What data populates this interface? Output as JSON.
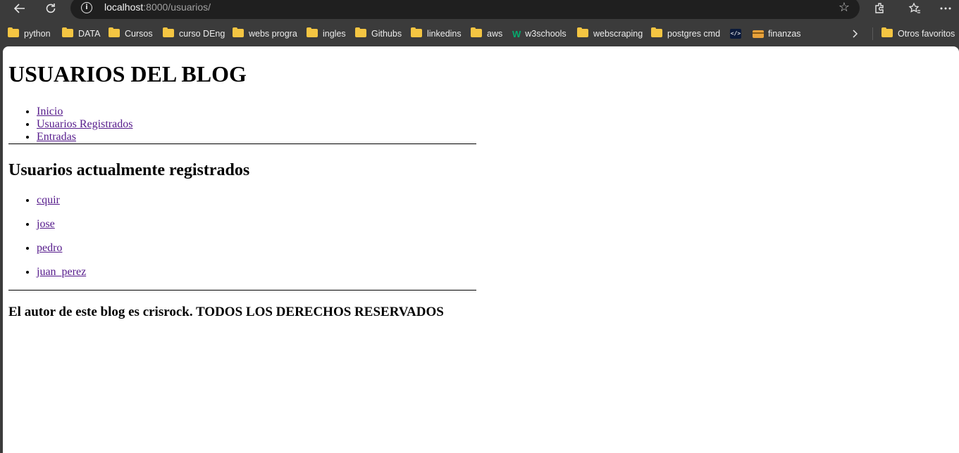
{
  "browser": {
    "address": {
      "host": "localhost",
      "path": ":8000/usuarios/"
    },
    "bookmarks": [
      {
        "label": "python",
        "icon": "folder-icon"
      },
      {
        "label": "DATA",
        "icon": "folder-icon"
      },
      {
        "label": "Cursos",
        "icon": "folder-icon"
      },
      {
        "label": "curso DEng",
        "icon": "folder-icon"
      },
      {
        "label": "webs progra",
        "icon": "folder-icon"
      },
      {
        "label": "ingles",
        "icon": "folder-icon"
      },
      {
        "label": "Githubs",
        "icon": "folder-icon"
      },
      {
        "label": "linkedins",
        "icon": "folder-icon"
      },
      {
        "label": "aws",
        "icon": "folder-icon"
      },
      {
        "label": "w3schools",
        "icon": "w3schools-icon"
      },
      {
        "label": "webscraping",
        "icon": "folder-icon"
      },
      {
        "label": "postgres cmd",
        "icon": "folder-icon"
      },
      {
        "label": "",
        "icon": "code-icon"
      },
      {
        "label": "finanzas",
        "icon": "card-icon"
      }
    ],
    "other_favorites": "Otros favoritos"
  },
  "page": {
    "title": "USUARIOS DEL BLOG",
    "nav": [
      "Inicio",
      "Usuarios Registrados",
      "Entradas"
    ],
    "section_title": "Usuarios actualmente registrados",
    "users": [
      "cquir",
      "jose",
      "pedro",
      "juan_perez"
    ],
    "footer": "El autor de este blog es crisrock. TODOS LOS DERECHOS RESERVADOS"
  },
  "colors": {
    "chrome_bg": "#3b3b3b",
    "address_bg": "#1f1f1f",
    "visited_link": "#551a8b"
  }
}
